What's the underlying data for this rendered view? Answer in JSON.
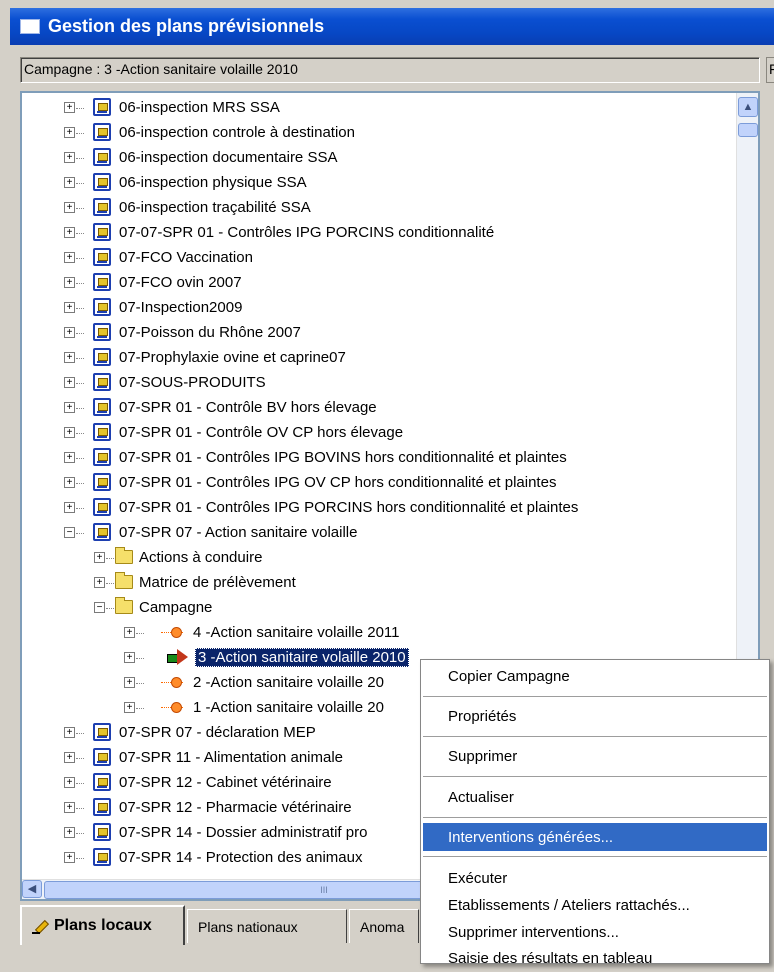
{
  "window": {
    "title": "Gestion des plans prévisionnels"
  },
  "campaign_bar": {
    "text": "Campagne : 3 -Action sanitaire volaille 2010",
    "right_fragment": "F"
  },
  "tree": {
    "plans_top": [
      "06-inspection MRS SSA",
      "06-inspection controle à destination",
      "06-inspection documentaire SSA",
      "06-inspection physique SSA",
      "06-inspection traçabilité SSA",
      "07-07-SPR 01 - Contrôles IPG PORCINS conditionnalité",
      "07-FCO Vaccination",
      "07-FCO ovin 2007",
      "07-Inspection2009",
      "07-Poisson du Rhône 2007",
      "07-Prophylaxie ovine et caprine07",
      "07-SOUS-PRODUITS",
      "07-SPR 01 - Contrôle BV hors élevage",
      "07-SPR 01 - Contrôle OV CP hors élevage",
      "07-SPR 01 - Contrôles IPG BOVINS hors conditionnalité et plaintes",
      "07-SPR 01 - Contrôles IPG OV CP hors conditionnalité et plaintes",
      "07-SPR 01 - Contrôles IPG PORCINS hors conditionnalité et plaintes"
    ],
    "expanded_plan": "07-SPR 07 -  Action sanitaire volaille",
    "folders": [
      "Actions à conduire",
      "Matrice de prélèvement",
      "Campagne"
    ],
    "campaigns": [
      "4 -Action sanitaire volaille 2011",
      "3 -Action sanitaire volaille 2010",
      "2 -Action sanitaire volaille 20",
      "1 -Action sanitaire volaille 20"
    ],
    "plans_bottom": [
      "07-SPR 07 - déclaration MEP",
      "07-SPR 11 - Alimentation animale",
      "07-SPR 12 -  Cabinet vétérinaire",
      "07-SPR 12 - Pharmacie vétérinaire",
      "07-SPR 14 - Dossier administratif pro",
      "07-SPR 14 - Protection des animaux"
    ],
    "expander_plus": "+",
    "expander_minus": "−"
  },
  "scrollbar": {
    "up": "▲",
    "left": "◀",
    "grip": "III"
  },
  "tabs": [
    "Plans locaux",
    "Plans nationaux",
    "Anoma"
  ],
  "context_menu": [
    "Copier Campagne",
    "Propriétés",
    "Supprimer",
    "Actualiser",
    "Interventions générées...",
    "Exécuter",
    "Etablissements / Ateliers rattachés...",
    "Supprimer interventions...",
    "Saisie des résultats en tableau"
  ],
  "colors": {
    "title_bar": "#0a4fd1",
    "selection": "#0a246a",
    "menu_highlight": "#316ac5"
  },
  "icons": {
    "plan": "plan-icon",
    "folder": "folder-icon",
    "campaign": "campaign-icon",
    "current": "arrow-icon"
  }
}
